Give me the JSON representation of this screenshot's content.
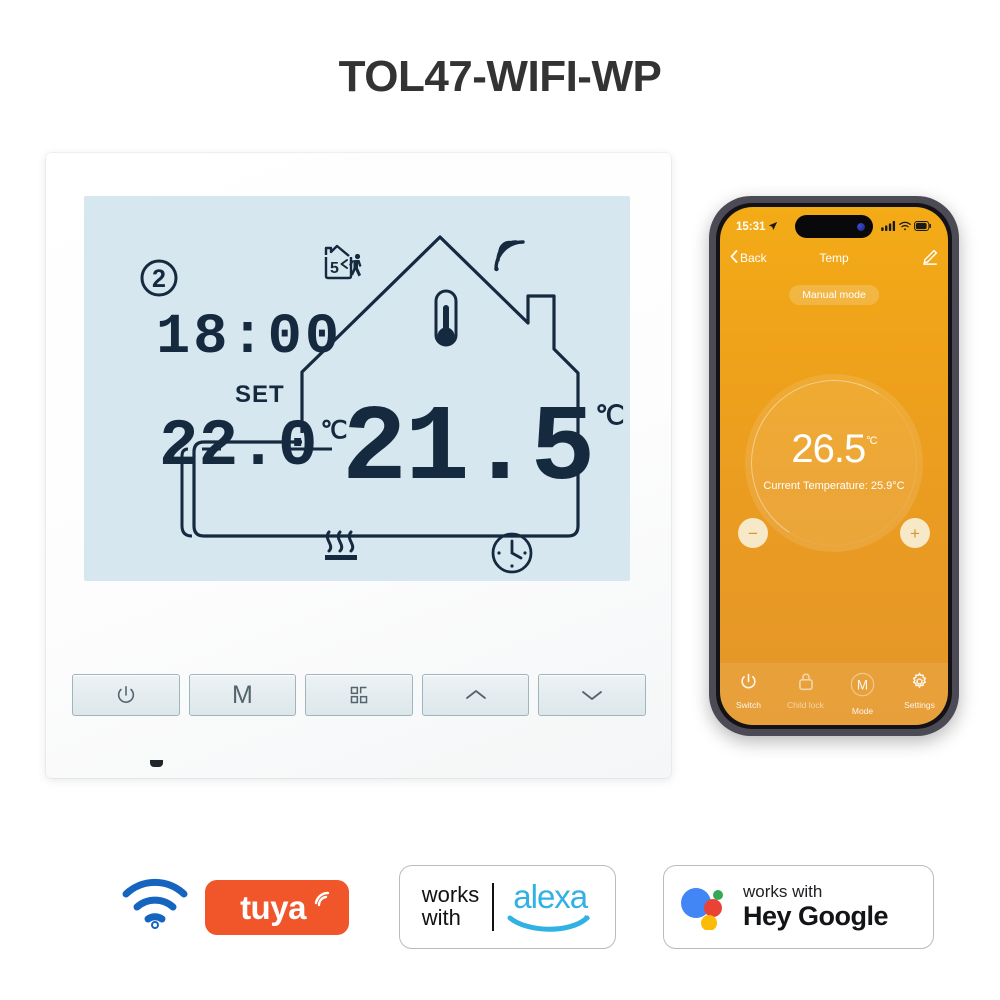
{
  "page": {
    "title": "TOL47-WIFI-WP"
  },
  "thermostat": {
    "lcd": {
      "day_number": "2",
      "clock": "18:00",
      "set_label": "SET",
      "set_temp": "22.0",
      "set_unit": "℃",
      "current_temp": "21.5",
      "current_unit": "℃",
      "away_icon_number": "5",
      "icons": {
        "away_house": "house-away-icon",
        "wifi": "wifi-signal-icon",
        "thermometer": "thermometer-icon",
        "heating": "heating-waves-icon",
        "clock": "clock-icon",
        "house_outline": "house-outline-icon"
      }
    },
    "buttons": [
      {
        "name": "power-button",
        "icon": "power-icon",
        "label": ""
      },
      {
        "name": "mode-button",
        "icon": "letter-m",
        "label": "M"
      },
      {
        "name": "menu-button",
        "icon": "grid-icon",
        "label": ""
      },
      {
        "name": "up-button",
        "icon": "chevron-up-icon",
        "label": ""
      },
      {
        "name": "down-button",
        "icon": "chevron-down-icon",
        "label": ""
      }
    ]
  },
  "phone": {
    "statusbar": {
      "time": "15:31"
    },
    "nav": {
      "back": "Back",
      "title": "Temp"
    },
    "mode_pill": "Manual mode",
    "dial": {
      "set_temp": "26.5",
      "set_unit": "°C",
      "current_line": "Current Temperature: 25.9°C",
      "minus": "−",
      "plus": "+"
    },
    "tabs": [
      {
        "label": "Switch",
        "icon": "power-icon"
      },
      {
        "label": "Child lock",
        "icon": "lock-icon"
      },
      {
        "label": "Mode",
        "icon": "letter-m-circle-icon"
      },
      {
        "label": "Settings",
        "icon": "gear-icon"
      }
    ]
  },
  "badges": {
    "wifi": {
      "name": "wifi-badge"
    },
    "tuya": {
      "word": "tuya"
    },
    "alexa": {
      "works": "works",
      "with": "with",
      "word": "alexa"
    },
    "google": {
      "works_with": "works with",
      "hey_google": "Hey Google"
    }
  },
  "colors": {
    "lcd_bg": "#d6e7f0",
    "lcd_ink": "#152a3e",
    "tuya_orange": "#f1552a",
    "alexa_blue": "#31b1e4",
    "phone_orange": "#eea11b",
    "google_blue": "#4285f4",
    "google_red": "#ea4335",
    "google_yellow": "#fbbc05",
    "google_green": "#34a853"
  }
}
